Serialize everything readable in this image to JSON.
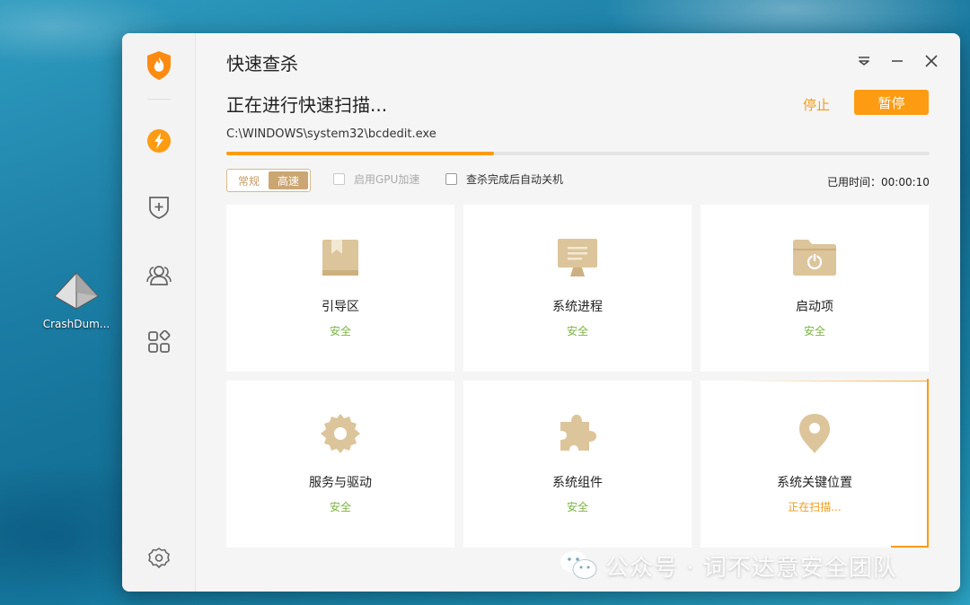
{
  "desktop": {
    "icon_label": "CrashDum..."
  },
  "window": {
    "title": "快速查杀",
    "status_text": "正在进行快速扫描...",
    "stop_label": "停止",
    "pause_label": "暂停",
    "current_file": "C:\\WINDOWS\\system32\\bcdedit.exe",
    "progress": 0.38,
    "mode": {
      "normal_label": "常规",
      "fast_label": "高速",
      "selected": "高速"
    },
    "gpu_label": "启用GPU加速",
    "gpu_checked": false,
    "auto_shutdown_label": "查杀完成后自动关机",
    "auto_shutdown_checked": false,
    "elapsed_label": "已用时间：00:00:10"
  },
  "sidebar": {
    "items": [
      {
        "icon": "shield-flame-logo-icon"
      },
      {
        "icon": "lightning-icon"
      },
      {
        "icon": "shield-plus-icon"
      },
      {
        "icon": "users-icon"
      },
      {
        "icon": "apps-grid-icon"
      },
      {
        "icon": "settings-gear-icon"
      }
    ]
  },
  "cards": [
    {
      "name": "引导区",
      "status": "安全",
      "icon": "book-icon"
    },
    {
      "name": "系统进程",
      "status": "安全",
      "icon": "monitor-icon"
    },
    {
      "name": "启动项",
      "status": "安全",
      "icon": "folder-power-icon"
    },
    {
      "name": "服务与驱动",
      "status": "安全",
      "icon": "gear-icon"
    },
    {
      "name": "系统组件",
      "status": "安全",
      "icon": "puzzle-icon"
    },
    {
      "name": "系统关键位置",
      "status": "正在扫描...",
      "icon": "location-pin-icon"
    }
  ],
  "colors": {
    "accent": "#fd9b12",
    "safe": "#7cb342",
    "icon_gold": "#d8bd8e"
  },
  "watermark": {
    "text": "公众号 · 词不达意安全团队"
  }
}
